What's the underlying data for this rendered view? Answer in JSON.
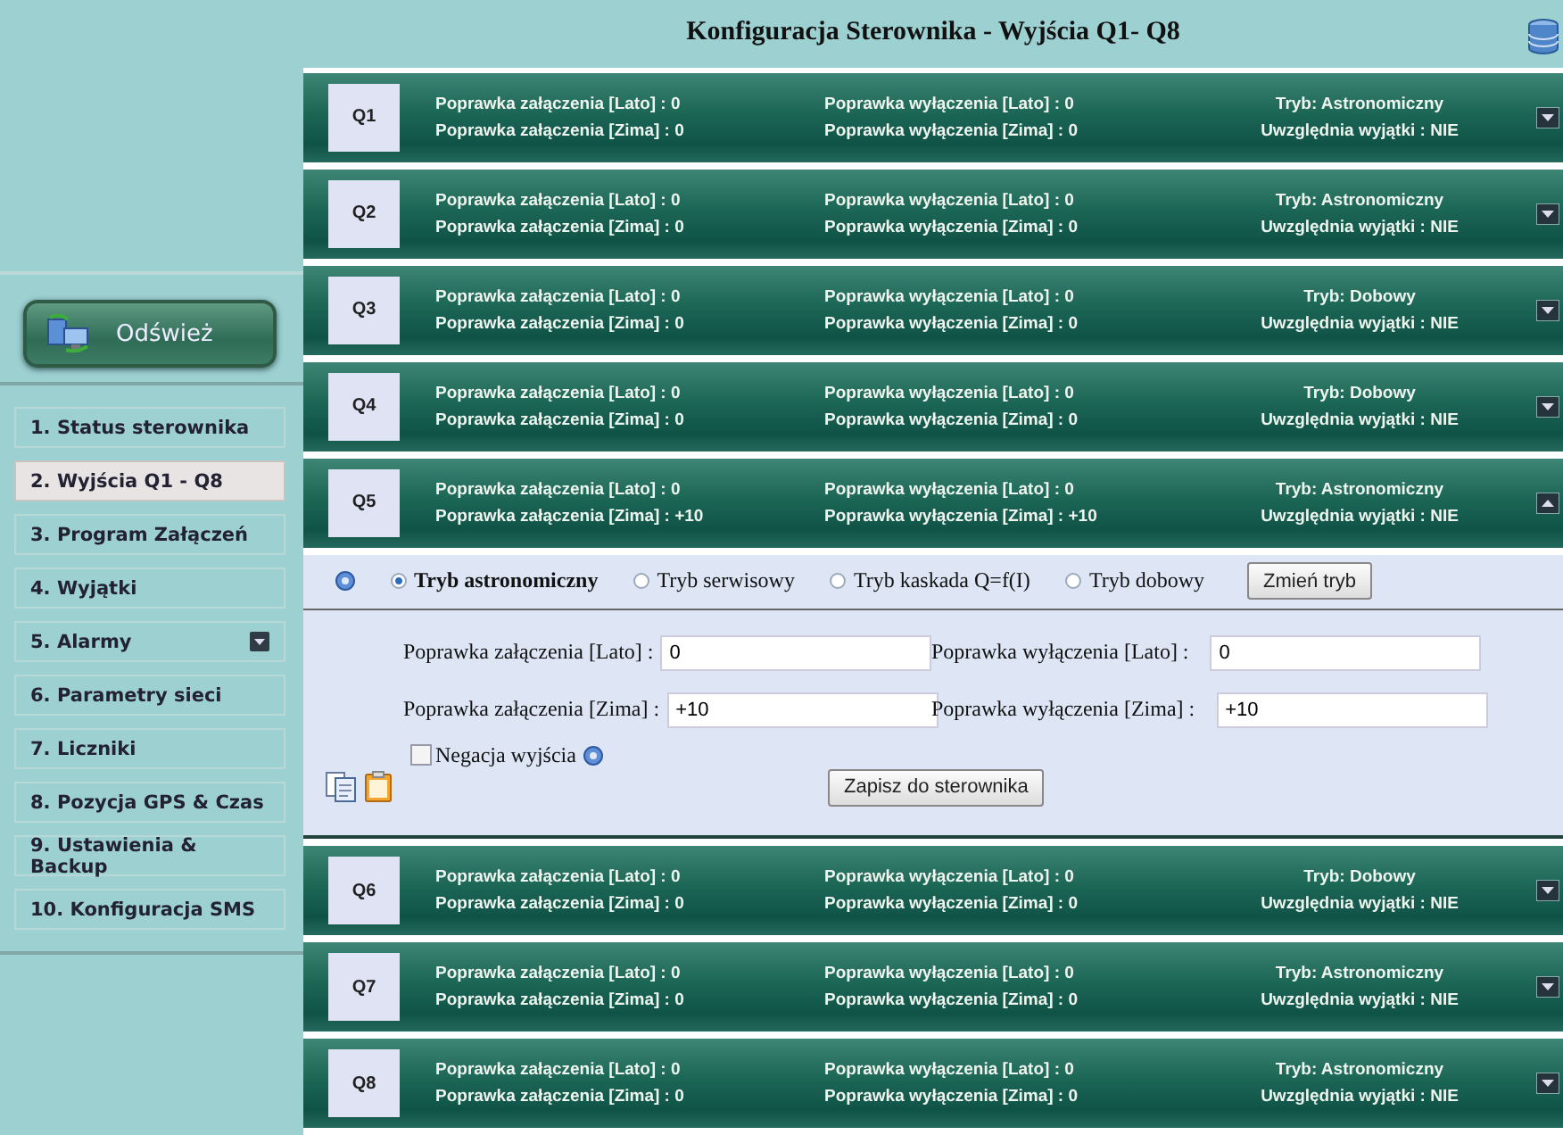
{
  "header": {
    "title": "Konfiguracja Sterownika - Wyjścia Q1- Q8"
  },
  "sidebar": {
    "refresh_button": "Odśwież",
    "items": [
      {
        "label": "1. Status sterownika",
        "selected": false,
        "kind": "link"
      },
      {
        "label": "2. Wyjścia Q1 - Q8",
        "selected": true,
        "kind": "link"
      },
      {
        "label": "3. Program Załączeń",
        "selected": false,
        "kind": "link"
      },
      {
        "label": "4. Wyjątki",
        "selected": false,
        "kind": "link"
      },
      {
        "label": "5. Alarmy",
        "selected": false,
        "kind": "dropdown"
      },
      {
        "label": "6. Parametry sieci",
        "selected": false,
        "kind": "link"
      },
      {
        "label": "7. Liczniki",
        "selected": false,
        "kind": "link"
      },
      {
        "label": "8. Pozycja GPS & Czas",
        "selected": false,
        "kind": "link"
      },
      {
        "label": "9. Ustawienia & Backup",
        "selected": false,
        "kind": "link"
      },
      {
        "label": "10. Konfiguracja SMS",
        "selected": false,
        "kind": "link"
      }
    ]
  },
  "outputs": [
    {
      "label": "Q1",
      "on_lato": "Poprawka załączenia [Lato] : 0",
      "on_zima": "Poprawka załączenia [Zima] : 0",
      "off_lato": "Poprawka wyłączenia [Lato] : 0",
      "off_zima": "Poprawka wyłączenia [Zima] : 0",
      "mode": "Tryb: Astronomiczny",
      "exceptions": "Uwzględnia wyjątki : NIE",
      "expanded": false
    },
    {
      "label": "Q2",
      "on_lato": "Poprawka załączenia [Lato] : 0",
      "on_zima": "Poprawka załączenia [Zima] : 0",
      "off_lato": "Poprawka wyłączenia [Lato] : 0",
      "off_zima": "Poprawka wyłączenia [Zima] : 0",
      "mode": "Tryb: Astronomiczny",
      "exceptions": "Uwzględnia wyjątki : NIE",
      "expanded": false
    },
    {
      "label": "Q3",
      "on_lato": "Poprawka załączenia [Lato] : 0",
      "on_zima": "Poprawka załączenia [Zima] : 0",
      "off_lato": "Poprawka wyłączenia [Lato] : 0",
      "off_zima": "Poprawka wyłączenia [Zima] : 0",
      "mode": "Tryb: Dobowy",
      "exceptions": "Uwzględnia wyjątki : NIE",
      "expanded": false
    },
    {
      "label": "Q4",
      "on_lato": "Poprawka załączenia [Lato] : 0",
      "on_zima": "Poprawka załączenia [Zima] : 0",
      "off_lato": "Poprawka wyłączenia [Lato] : 0",
      "off_zima": "Poprawka wyłączenia [Zima] : 0",
      "mode": "Tryb: Dobowy",
      "exceptions": "Uwzględnia wyjątki : NIE",
      "expanded": false
    },
    {
      "label": "Q5",
      "on_lato": "Poprawka załączenia [Lato] : 0",
      "on_zima": "Poprawka załączenia [Zima] : +10",
      "off_lato": "Poprawka wyłączenia [Lato] : 0",
      "off_zima": "Poprawka wyłączenia [Zima] : +10",
      "mode": "Tryb: Astronomiczny",
      "exceptions": "Uwzględnia wyjątki : NIE",
      "expanded": true,
      "details": {
        "modes": [
          {
            "label": "Tryb astronomiczny",
            "selected": true
          },
          {
            "label": "Tryb serwisowy",
            "selected": false
          },
          {
            "label": "Tryb kaskada Q=f(I)",
            "selected": false
          },
          {
            "label": "Tryb dobowy",
            "selected": false
          }
        ],
        "change_mode_button": "Zmień tryb",
        "fields": [
          {
            "label": "Poprawka załączenia [Lato] :",
            "value": "0"
          },
          {
            "label": "Poprawka wyłączenia [Lato] :",
            "value": "0"
          },
          {
            "label": "Poprawka załączenia [Zima] :",
            "value": "+10"
          },
          {
            "label": "Poprawka wyłączenia [Zima] :",
            "value": "+10"
          }
        ],
        "negation": {
          "label": "Negacja wyjścia",
          "checked": false
        },
        "save_button": "Zapisz do sterownika"
      }
    },
    {
      "label": "Q6",
      "on_lato": "Poprawka załączenia [Lato] : 0",
      "on_zima": "Poprawka załączenia [Zima] : 0",
      "off_lato": "Poprawka wyłączenia [Lato] : 0",
      "off_zima": "Poprawka wyłączenia [Zima] : 0",
      "mode": "Tryb: Dobowy",
      "exceptions": "Uwzględnia wyjątki : NIE",
      "expanded": false
    },
    {
      "label": "Q7",
      "on_lato": "Poprawka załączenia [Lato] : 0",
      "on_zima": "Poprawka załączenia [Zima] : 0",
      "off_lato": "Poprawka wyłączenia [Lato] : 0",
      "off_zima": "Poprawka wyłączenia [Zima] : 0",
      "mode": "Tryb: Astronomiczny",
      "exceptions": "Uwzględnia wyjątki : NIE",
      "expanded": false
    },
    {
      "label": "Q8",
      "on_lato": "Poprawka załączenia [Lato] : 0",
      "on_zima": "Poprawka załączenia [Zima] : 0",
      "off_lato": "Poprawka wyłączenia [Lato] : 0",
      "off_zima": "Poprawka wyłączenia [Zima] : 0",
      "mode": "Tryb: Astronomiczny",
      "exceptions": "Uwzględnia wyjątki : NIE",
      "expanded": false
    }
  ]
}
